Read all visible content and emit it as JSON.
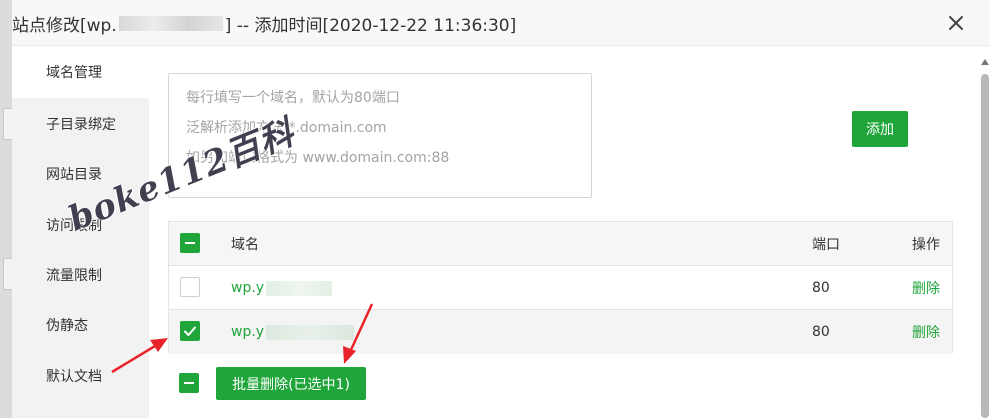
{
  "dialog": {
    "title_prefix": "站点修改[wp.",
    "title_suffix": "] -- 添加时间[2020-12-22 11:36:30]"
  },
  "sidebar": {
    "items": [
      {
        "label": "域名管理",
        "active": true
      },
      {
        "label": "子目录绑定"
      },
      {
        "label": "网站目录"
      },
      {
        "label": "访问限制"
      },
      {
        "label": "流量限制"
      },
      {
        "label": "伪静态"
      },
      {
        "label": "默认文档"
      }
    ]
  },
  "domain_input": {
    "placeholder_lines": [
      "每行填写一个域名，默认为80端口",
      "泛解析添加方法 *.domain.com",
      "如另加端口格式为 www.domain.com:88"
    ]
  },
  "add_button": "添加",
  "table": {
    "headers": {
      "domain": "域名",
      "port": "端口",
      "action": "操作"
    },
    "rows": [
      {
        "domain": "wp.y",
        "port": "80",
        "action": "删除",
        "checked": false
      },
      {
        "domain": "wp.y",
        "port": "80",
        "action": "删除",
        "checked": true
      }
    ]
  },
  "batch_delete_button": "批量删除(已选中1)",
  "watermark": "boke112百科",
  "colors": {
    "accent": "#20a53a",
    "arrow": "#e8242a"
  }
}
